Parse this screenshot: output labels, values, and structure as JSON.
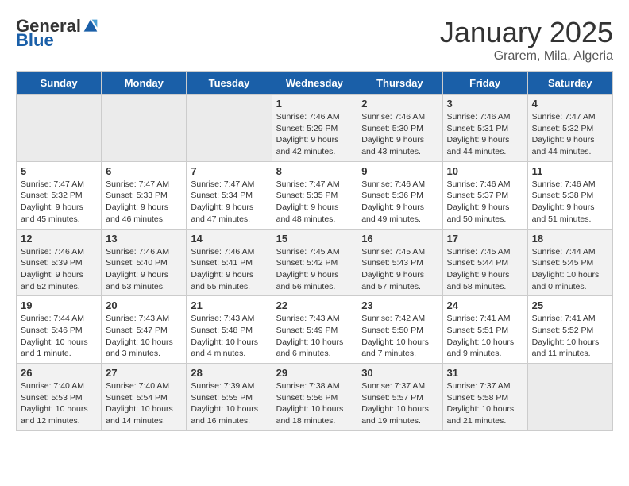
{
  "logo": {
    "general": "General",
    "blue": "Blue"
  },
  "title": "January 2025",
  "location": "Grarem, Mila, Algeria",
  "days_of_week": [
    "Sunday",
    "Monday",
    "Tuesday",
    "Wednesday",
    "Thursday",
    "Friday",
    "Saturday"
  ],
  "weeks": [
    [
      {
        "day": "",
        "info": ""
      },
      {
        "day": "",
        "info": ""
      },
      {
        "day": "",
        "info": ""
      },
      {
        "day": "1",
        "info": "Sunrise: 7:46 AM\nSunset: 5:29 PM\nDaylight: 9 hours and 42 minutes."
      },
      {
        "day": "2",
        "info": "Sunrise: 7:46 AM\nSunset: 5:30 PM\nDaylight: 9 hours and 43 minutes."
      },
      {
        "day": "3",
        "info": "Sunrise: 7:46 AM\nSunset: 5:31 PM\nDaylight: 9 hours and 44 minutes."
      },
      {
        "day": "4",
        "info": "Sunrise: 7:47 AM\nSunset: 5:32 PM\nDaylight: 9 hours and 44 minutes."
      }
    ],
    [
      {
        "day": "5",
        "info": "Sunrise: 7:47 AM\nSunset: 5:32 PM\nDaylight: 9 hours and 45 minutes."
      },
      {
        "day": "6",
        "info": "Sunrise: 7:47 AM\nSunset: 5:33 PM\nDaylight: 9 hours and 46 minutes."
      },
      {
        "day": "7",
        "info": "Sunrise: 7:47 AM\nSunset: 5:34 PM\nDaylight: 9 hours and 47 minutes."
      },
      {
        "day": "8",
        "info": "Sunrise: 7:47 AM\nSunset: 5:35 PM\nDaylight: 9 hours and 48 minutes."
      },
      {
        "day": "9",
        "info": "Sunrise: 7:46 AM\nSunset: 5:36 PM\nDaylight: 9 hours and 49 minutes."
      },
      {
        "day": "10",
        "info": "Sunrise: 7:46 AM\nSunset: 5:37 PM\nDaylight: 9 hours and 50 minutes."
      },
      {
        "day": "11",
        "info": "Sunrise: 7:46 AM\nSunset: 5:38 PM\nDaylight: 9 hours and 51 minutes."
      }
    ],
    [
      {
        "day": "12",
        "info": "Sunrise: 7:46 AM\nSunset: 5:39 PM\nDaylight: 9 hours and 52 minutes."
      },
      {
        "day": "13",
        "info": "Sunrise: 7:46 AM\nSunset: 5:40 PM\nDaylight: 9 hours and 53 minutes."
      },
      {
        "day": "14",
        "info": "Sunrise: 7:46 AM\nSunset: 5:41 PM\nDaylight: 9 hours and 55 minutes."
      },
      {
        "day": "15",
        "info": "Sunrise: 7:45 AM\nSunset: 5:42 PM\nDaylight: 9 hours and 56 minutes."
      },
      {
        "day": "16",
        "info": "Sunrise: 7:45 AM\nSunset: 5:43 PM\nDaylight: 9 hours and 57 minutes."
      },
      {
        "day": "17",
        "info": "Sunrise: 7:45 AM\nSunset: 5:44 PM\nDaylight: 9 hours and 58 minutes."
      },
      {
        "day": "18",
        "info": "Sunrise: 7:44 AM\nSunset: 5:45 PM\nDaylight: 10 hours and 0 minutes."
      }
    ],
    [
      {
        "day": "19",
        "info": "Sunrise: 7:44 AM\nSunset: 5:46 PM\nDaylight: 10 hours and 1 minute."
      },
      {
        "day": "20",
        "info": "Sunrise: 7:43 AM\nSunset: 5:47 PM\nDaylight: 10 hours and 3 minutes."
      },
      {
        "day": "21",
        "info": "Sunrise: 7:43 AM\nSunset: 5:48 PM\nDaylight: 10 hours and 4 minutes."
      },
      {
        "day": "22",
        "info": "Sunrise: 7:43 AM\nSunset: 5:49 PM\nDaylight: 10 hours and 6 minutes."
      },
      {
        "day": "23",
        "info": "Sunrise: 7:42 AM\nSunset: 5:50 PM\nDaylight: 10 hours and 7 minutes."
      },
      {
        "day": "24",
        "info": "Sunrise: 7:41 AM\nSunset: 5:51 PM\nDaylight: 10 hours and 9 minutes."
      },
      {
        "day": "25",
        "info": "Sunrise: 7:41 AM\nSunset: 5:52 PM\nDaylight: 10 hours and 11 minutes."
      }
    ],
    [
      {
        "day": "26",
        "info": "Sunrise: 7:40 AM\nSunset: 5:53 PM\nDaylight: 10 hours and 12 minutes."
      },
      {
        "day": "27",
        "info": "Sunrise: 7:40 AM\nSunset: 5:54 PM\nDaylight: 10 hours and 14 minutes."
      },
      {
        "day": "28",
        "info": "Sunrise: 7:39 AM\nSunset: 5:55 PM\nDaylight: 10 hours and 16 minutes."
      },
      {
        "day": "29",
        "info": "Sunrise: 7:38 AM\nSunset: 5:56 PM\nDaylight: 10 hours and 18 minutes."
      },
      {
        "day": "30",
        "info": "Sunrise: 7:37 AM\nSunset: 5:57 PM\nDaylight: 10 hours and 19 minutes."
      },
      {
        "day": "31",
        "info": "Sunrise: 7:37 AM\nSunset: 5:58 PM\nDaylight: 10 hours and 21 minutes."
      },
      {
        "day": "",
        "info": ""
      }
    ]
  ]
}
